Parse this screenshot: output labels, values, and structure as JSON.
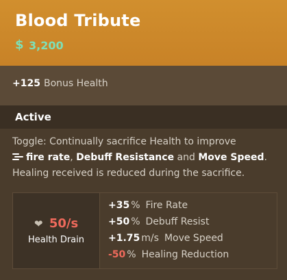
{
  "item": {
    "title": "Blood Tribute",
    "cost_icon": "soul-currency-icon",
    "cost": "3,200",
    "colors": {
      "header": "#cf8a2a",
      "cost": "#7de0b8",
      "negative": "#f06a5c"
    }
  },
  "bonus": {
    "value": "+125",
    "label": "Bonus Health"
  },
  "active": {
    "label": "Active",
    "description": {
      "part1": "Toggle: Continually sacrifice Health to improve",
      "icon": "fire-rate-icon",
      "fire_rate": "fire rate",
      "comma": ",",
      "debuff": "Debuff Resistance",
      "and": "and",
      "move": "Move Speed",
      "period": ".",
      "part2": "Healing received is reduced during the sacrifice."
    }
  },
  "drain": {
    "icon": "broken-heart-icon",
    "value": "50/s",
    "label": "Health Drain"
  },
  "modifiers": [
    {
      "value": "+35",
      "unit": "%",
      "label": "Fire Rate"
    },
    {
      "value": "+50",
      "unit": "%",
      "label": "Debuff Resist"
    },
    {
      "value": "+1.75",
      "unit": "m/s",
      "label": "Move Speed"
    },
    {
      "value": "-50",
      "unit": "%",
      "label": "Healing Reduction"
    }
  ]
}
